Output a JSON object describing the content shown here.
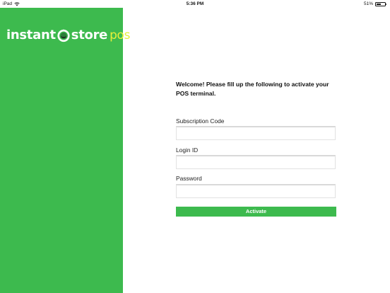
{
  "status_bar": {
    "device": "iPad",
    "time": "5:36 PM",
    "battery_percent_label": "51%",
    "battery_level": 0.51
  },
  "brand": {
    "logo_word1": "instant",
    "logo_word2": "store",
    "logo_suffix": "pos",
    "primary_color": "#3dba4e",
    "accent_color": "#e6f03a"
  },
  "form": {
    "welcome": "Welcome! Please fill up the following to activate your POS terminal.",
    "fields": [
      {
        "label": "Subscription Code",
        "value": ""
      },
      {
        "label": "Login ID",
        "value": ""
      },
      {
        "label": "Password",
        "value": ""
      }
    ],
    "activate_label": "Activate"
  }
}
